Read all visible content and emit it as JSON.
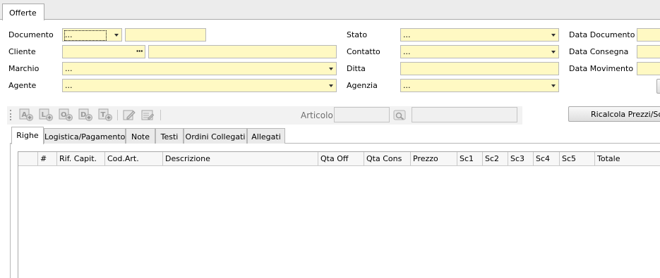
{
  "window": {
    "tab_label": "Offerte"
  },
  "form": {
    "documento": {
      "label": "Documento",
      "value": "...",
      "number": ""
    },
    "cliente": {
      "label": "Cliente",
      "code": "",
      "name": ""
    },
    "marchio": {
      "label": "Marchio",
      "value": "..."
    },
    "agente": {
      "label": "Agente",
      "value": "..."
    },
    "stato": {
      "label": "Stato",
      "value": "..."
    },
    "contatto": {
      "label": "Contatto",
      "value": "..."
    },
    "ditta": {
      "label": "Ditta",
      "value": ""
    },
    "agenzia": {
      "label": "Agenzia",
      "value": "..."
    },
    "data_documento": {
      "label": "Data Documento",
      "value": ""
    },
    "data_consegna": {
      "label": "Data Consegna",
      "value": ""
    },
    "data_movimento": {
      "label": "Data Movimento",
      "value": ""
    }
  },
  "toolbar": {
    "icons": [
      "add-a-icon",
      "add-l-icon",
      "add-o-icon",
      "add-d-icon",
      "add-t-icon",
      "edit-icon",
      "edit-list-icon"
    ],
    "icon_letters": [
      "A",
      "L",
      "O",
      "D",
      "T"
    ],
    "articolo_label": "Articolo",
    "articolo_code": "",
    "articolo_desc": "",
    "ricalcola_label": "Ricalcola Prezzi/Sconti"
  },
  "tabs": [
    "Righe",
    "Logistica/Pagamento",
    "Note",
    "Testi",
    "Ordini Collegati",
    "Allegati"
  ],
  "grid": {
    "columns": [
      "",
      "#",
      "Rif. Capit.",
      "Cod.Art.",
      "Descrizione",
      "Qta Off",
      "Qta Cons",
      "Prezzo",
      "Sc1",
      "Sc2",
      "Sc3",
      "Sc4",
      "Sc5",
      "Totale"
    ],
    "rows": []
  },
  "colors": {
    "field_bg": "#fff9c3",
    "tab_strip": "#ececec"
  }
}
